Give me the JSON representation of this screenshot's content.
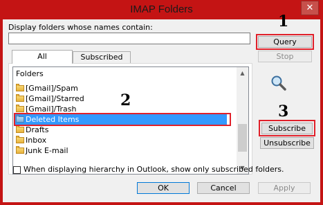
{
  "window": {
    "title": "IMAP Folders",
    "close_glyph": "✕"
  },
  "filter": {
    "label": "Display folders whose names contain:",
    "value": ""
  },
  "buttons": {
    "query": "Query",
    "stop": "Stop",
    "subscribe": "Subscribe",
    "unsubscribe": "Unsubscribe",
    "ok": "OK",
    "cancel": "Cancel",
    "apply": "Apply"
  },
  "tabs": [
    {
      "label": "All"
    },
    {
      "label": "Subscribed"
    }
  ],
  "list": {
    "header": "Folders",
    "items": [
      {
        "label": "[Gmail]/Spam"
      },
      {
        "label": "[Gmail]/Starred"
      },
      {
        "label": "[Gmail]/Trash"
      },
      {
        "label": "Deleted Items",
        "selected": true
      },
      {
        "label": "Drafts"
      },
      {
        "label": "Inbox"
      },
      {
        "label": "Junk E-mail"
      }
    ]
  },
  "checkbox": {
    "label": "When displaying hierarchy in Outlook, show only subscribed folders.",
    "checked": false
  },
  "annotations": {
    "one": "1",
    "two": "2",
    "three": "3"
  },
  "icons": {
    "search": "magnifier-icon"
  },
  "colors": {
    "frame": "#c41414",
    "highlight": "#e0202a",
    "selection": "#3399ff"
  }
}
